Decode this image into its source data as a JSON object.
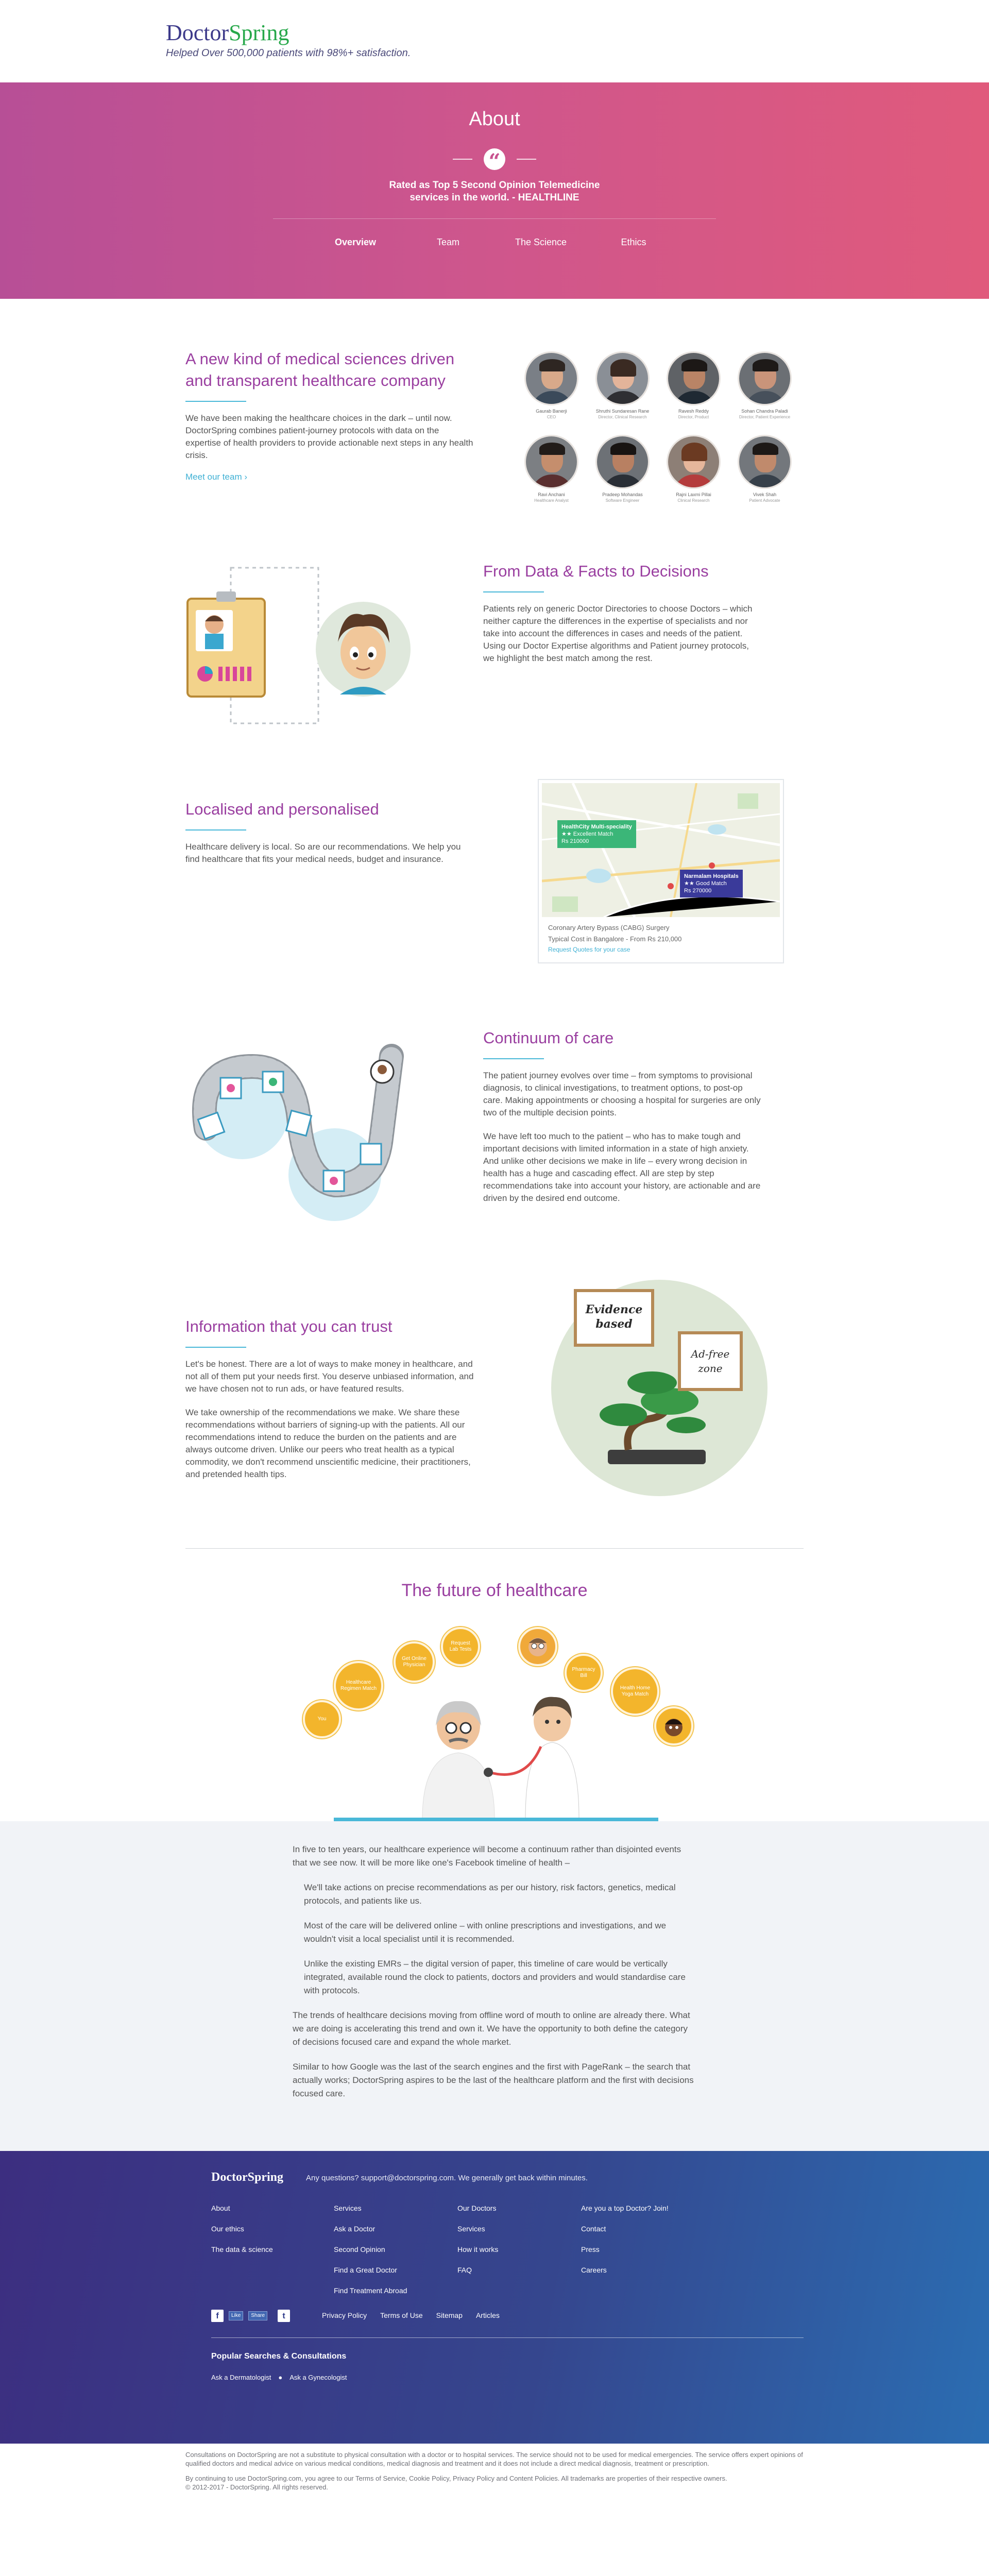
{
  "header": {
    "logo_part1": "Doctor",
    "logo_part2": "Spring",
    "tagline": "Helped Over 500,000 patients with 98%+ satisfaction."
  },
  "hero": {
    "title": "About",
    "quote_line1": "Rated as Top 5 Second Opinion Telemedicine",
    "quote_line2": "services in the world. - HEALTHLINE",
    "nav": [
      "Overview",
      "Team",
      "The Science",
      "Ethics"
    ]
  },
  "intro": {
    "title_line1": "A new kind of medical sciences driven",
    "title_line2": "and transparent healthcare company",
    "body": "We have been making the healthcare choices in the dark – until now. DoctorSpring combines patient-journey protocols with data on the expertise of health providers to provide actionable next steps in any health crisis.",
    "link": "Meet our team",
    "team": [
      {
        "name": "Gaurab Banerji",
        "role": "CEO"
      },
      {
        "name": "Shruthi Sundaresan Rane",
        "role": "Director, Clinical Research"
      },
      {
        "name": "Ravesh Reddy",
        "role": "Director, Product"
      },
      {
        "name": "Sohan Chandra Paladi",
        "role": "Director, Patient Experience"
      },
      {
        "name": "Ravi Anchani",
        "role": "Healthcare Analyst"
      },
      {
        "name": "Pradeep Mohandas",
        "role": "Software Engineer"
      },
      {
        "name": "Rajni Laxmi Pillai",
        "role": "Clinical Research"
      },
      {
        "name": "Vivek Shah",
        "role": "Patient Advocate"
      }
    ]
  },
  "data_facts": {
    "title": "From Data & Facts to Decisions",
    "body": "Patients rely on generic Doctor Directories to choose Doctors – which neither capture the differences in the expertise of specialists and nor take into account the differences in cases and needs of the patient. Using our Doctor Expertise algorithms and Patient journey protocols, we highlight the best match among the rest."
  },
  "localised": {
    "title": "Localised and personalised",
    "body": "Healthcare delivery is local. So are our recommendations. We help you find healthcare that fits your medical needs, budget and insurance.",
    "map_pin1_title": "HealthCity Multi-speciality",
    "map_pin1_match": "★★ Excellent Match",
    "map_pin1_price": "Rs 210000",
    "map_pin2_title": "Narmalam Hospitals",
    "map_pin2_match": "★★ Good Match",
    "map_pin2_price": "Rs 270000",
    "map_line1": "Coronary Artery Bypass (CABG) Surgery",
    "map_line2": "Typical Cost in Bangalore - From Rs 210,000",
    "map_link": "Request Quotes for your case"
  },
  "continuum": {
    "title": "Continuum of care",
    "para1": "The patient journey evolves over time – from symptoms to provisional diagnosis, to clinical investigations, to treatment options, to post-op care. Making appointments or choosing a hospital for surgeries are only two of the multiple decision points.",
    "para2": "We have left too much to the patient – who has to make tough and important decisions with limited information in a state of high anxiety. And unlike other decisions we make in life – every wrong decision in health has a huge and cascading effect. All are step by step recommendations take into account your history, are actionable and are driven by the desired end outcome."
  },
  "trust": {
    "title": "Information that you can trust",
    "para1": "Let's be honest. There are a lot of ways to make money in healthcare, and not all of them put your needs first. You deserve unbiased information, and we have chosen not to run ads, or have featured results.",
    "para2": "We take ownership of the recommendations we make. We share these recommendations without barriers of signing-up with the patients. All our recommendations intend to reduce the burden on the patients and are always outcome driven. Unlike our peers who treat health as a typical commodity, we don't recommend unscientific medicine, their practitioners, and pretended health tips.",
    "sign1_line1": "Evidence",
    "sign1_line2": "based",
    "sign2_line1": "Ad-free",
    "sign2_line2": "zone"
  },
  "future": {
    "title": "The future of healthcare",
    "bubbles": [
      "You",
      "Healthcare Regimen Match",
      "Get Online Physician",
      "Request Lab Tests",
      "",
      "Pharmacy Bill",
      "Health Home Yoga Match",
      ""
    ],
    "intro": "In five to ten years, our healthcare experience will become a continuum rather than disjointed events that we see now. It will be more like one's Facebook timeline of health –",
    "bullet1": "We'll take actions on precise recommendations as per our history, risk factors, genetics, medical protocols, and patients like us.",
    "bullet2": "Most of the care will be delivered online – with online prescriptions and investigations, and we wouldn't visit a local specialist until it is recommended.",
    "bullet3": "Unlike the existing EMRs – the digital version of paper, this timeline of care would be vertically integrated, available round the clock to patients, doctors and providers and would standardise care with protocols.",
    "para2": "The trends of healthcare decisions moving from offline word of mouth to online are already there. What we are doing is accelerating this trend and own it. We have the opportunity to both define the category of decisions focused care and expand the whole market.",
    "para3": "Similar to how Google was the last of the search engines and the first with PageRank – the search that actually works; DoctorSpring aspires to be the last of the healthcare platform and the first with decisions focused care."
  },
  "footer": {
    "brand": "DoctorSpring",
    "contact": "Any questions? support@doctorspring.com. We generally get back within minutes.",
    "col1": [
      "About",
      "Our ethics",
      "The data & science"
    ],
    "col2": [
      "Services",
      "Ask a Doctor",
      "Second Opinion",
      "Find a Great Doctor",
      "Find Treatment Abroad"
    ],
    "col3": [
      "Our Doctors",
      "Services",
      "How it works",
      "FAQ"
    ],
    "col4": [
      "Are you a top Doctor? Join!",
      "Contact",
      "Press",
      "Careers"
    ],
    "fb_like": "Like",
    "fb_share": "Share",
    "legal": [
      "Privacy Policy",
      "Terms of Use",
      "Sitemap",
      "Articles"
    ],
    "popular_title": "Popular Searches & Consultations",
    "popular": [
      "Ask a Dermatologist",
      "Ask a Gynecologist"
    ]
  },
  "disclaimer": {
    "p1": "Consultations on DoctorSpring are not a substitute to physical consultation with a doctor or to hospital services. The service should not to be used for medical emergencies. The service offers expert opinions of qualified doctors and medical advice on various medical conditions, medical diagnosis and treatment and it does not include a direct medical diagnosis, treatment or prescription.",
    "p2": "By continuing to use DoctorSpring.com, you agree to our Terms of Service, Cookie Policy, Privacy Policy and Content Policies. All trademarks are properties of their respective owners.",
    "p3": "© 2012-2017 - DoctorSpring. All rights reserved."
  },
  "colors": {
    "hero_start": "#b74f96",
    "hero_end": "#e05a7c",
    "heading": "#9a3fa0",
    "accent_rule": "#49b8d8",
    "footer_start": "#3c2e80",
    "footer_end": "#2b6db2"
  }
}
